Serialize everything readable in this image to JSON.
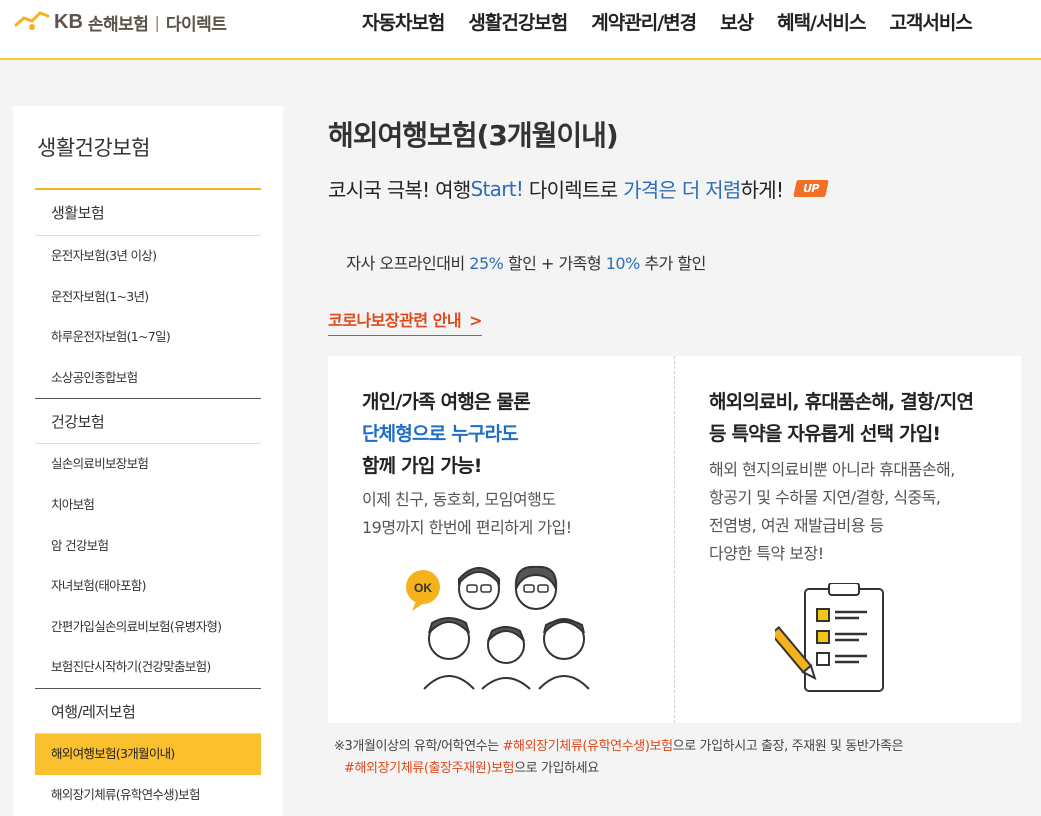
{
  "header": {
    "logo_kb": "KB",
    "logo_brand": "손해보험",
    "logo_separator": "|",
    "logo_sub": "다이렉트",
    "nav": [
      "자동차보험",
      "생활건강보험",
      "계약관리/변경",
      "보상",
      "혜택/서비스",
      "고객서비스"
    ]
  },
  "sidebar": {
    "title": "생활건강보험",
    "groups": [
      {
        "label": "생활보험",
        "items": [
          "운전자보험(3년 이상)",
          "운전자보험(1~3년)",
          "하루운전자보험(1~7일)",
          "소상공인종합보험"
        ]
      },
      {
        "label": "건강보험",
        "items": [
          "실손의료비보장보험",
          "치아보험",
          "암 건강보험",
          "자녀보험(태아포함)",
          "간편가입실손의료비보험(유병자형)",
          "보험진단시작하기(건강맞춤보험)"
        ]
      },
      {
        "label": "여행/레저보험",
        "items": [
          "해외여행보험(3개월이내)",
          "해외장기체류(유학연수생)보험"
        ]
      }
    ],
    "active_item": "해외여행보험(3개월이내)"
  },
  "main": {
    "title": "해외여행보험(3개월이내)",
    "headline": {
      "part1": "코시국 극복! 여행 ",
      "part2": "Start!",
      "part3": " 다이렉트로 ",
      "part4": "가격은 더 저렴",
      "part5": "하게!",
      "badge": "UP"
    },
    "discount": {
      "part1": "자사 오프라인대비 ",
      "part2": "25%",
      "part3": " 할인 + 가족형 ",
      "part4": "10%",
      "part5": " 추가 할인"
    },
    "corona_link": "코로나보장관련 안내",
    "corona_chevron": ">",
    "card1": {
      "head1": "개인/가족 여행은 물론",
      "head2": "단체형으로 누구라도",
      "head3": "함께 가입 가능!",
      "body1": "이제 친구, 동호회, 모임여행도",
      "body2": "19명까지 한번에 편리하게 가입!",
      "ok_bubble": "OK"
    },
    "card2": {
      "head1": "해외의료비, 휴대품손해, 결항/지연",
      "head2": "등 특약을 자유롭게 선택 가입!",
      "body1": "해외 현지의료비뿐 아니라 휴대품손해,",
      "body2": "항공기 및 수하물 지연/결항, 식중독,",
      "body3": "전염병, 여권 재발급비용 등",
      "body4": "다양한 특약 보장!"
    },
    "notice": {
      "part1": "※3개월이상의 유학/어학연수는 ",
      "link1": "#해외장기체류(유학연수생)보험",
      "part2": "으로 가입하시고 출장, 주재원 및 동반가족은",
      "link2": "#해외장기체류(출장주재원)보험",
      "part3": "으로 가입하세요"
    }
  },
  "colors": {
    "accent": "#fbc02d",
    "blue": "#2a6ebb",
    "orange": "#e0491b"
  }
}
